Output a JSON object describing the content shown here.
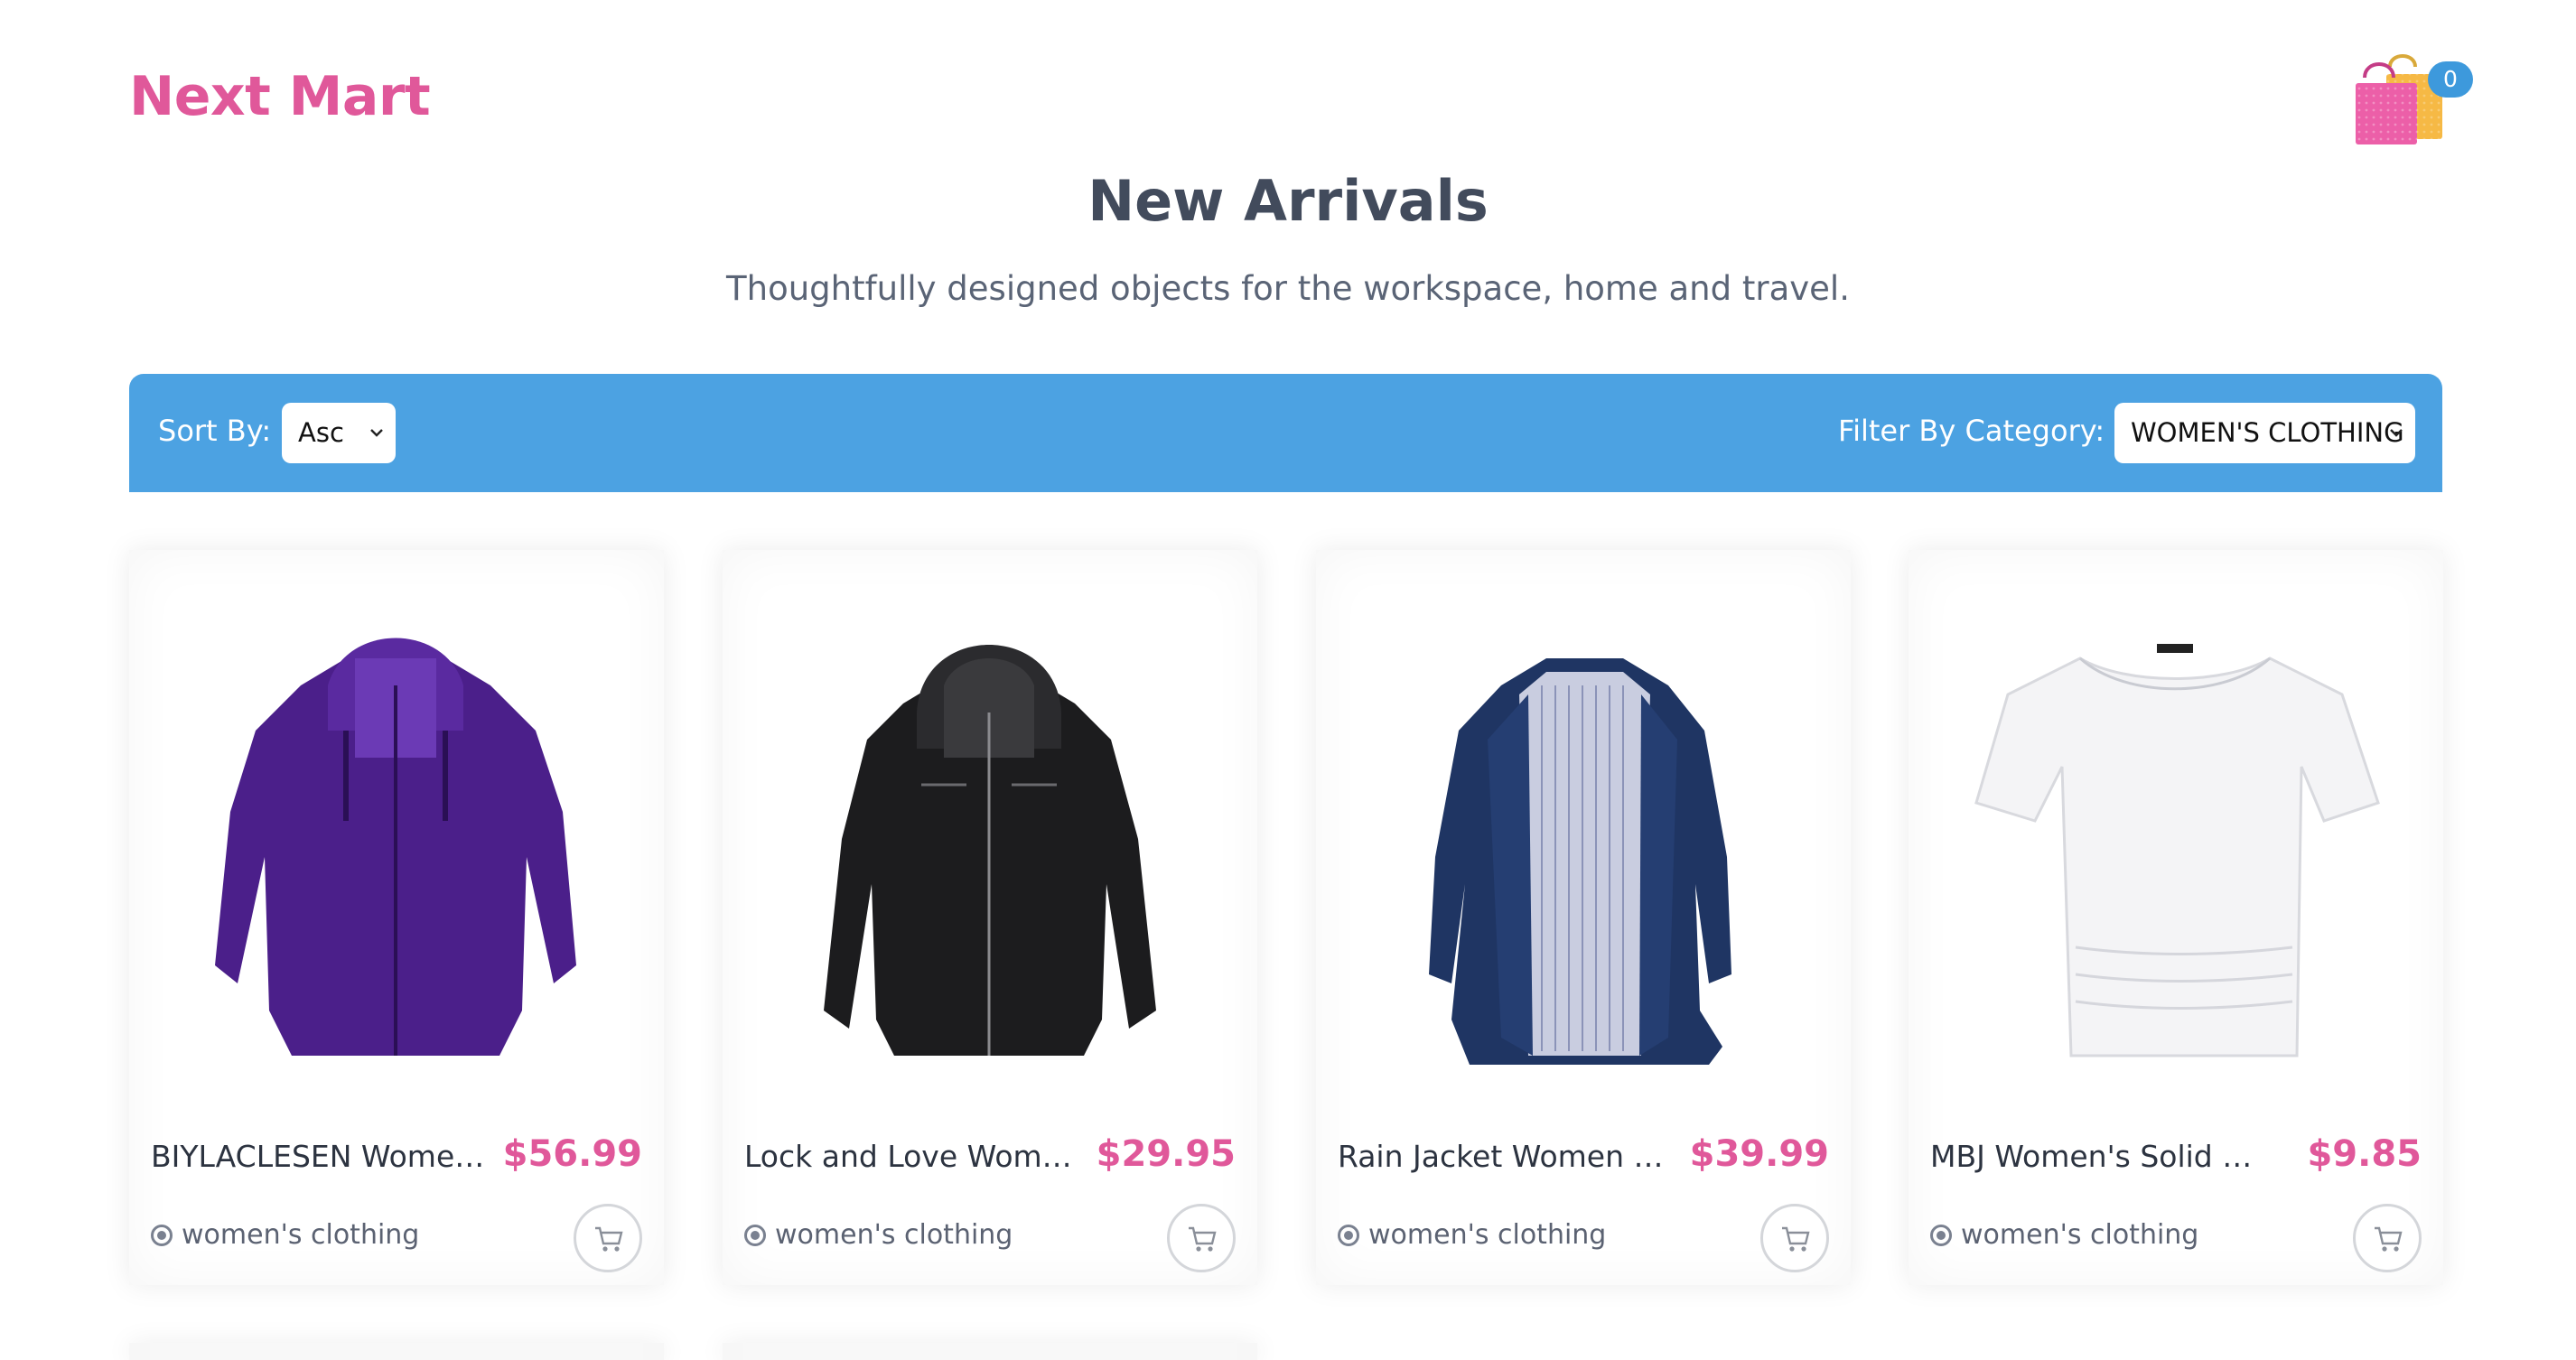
{
  "header": {
    "brand": "Next Mart",
    "cart_icon": "shopping-bags-icon",
    "cart_count": "0"
  },
  "hero": {
    "title": "New Arrivals",
    "subtitle": "Thoughtfully designed objects for the workspace, home and travel."
  },
  "toolbar": {
    "sort_label": "Sort By:",
    "sort_value": "Asc",
    "filter_label": "Filter By Category:",
    "filter_value": "WOMEN'S CLOTHING"
  },
  "products": [
    {
      "title": "BIYLACLESEN Women's ...",
      "price": "$56.99",
      "category": "women's clothing",
      "image": "purple-jacket"
    },
    {
      "title": "Lock and Love Women'...",
      "price": "$29.95",
      "category": "women's clothing",
      "image": "black-leather-jacket"
    },
    {
      "title": "Rain Jacket Women Wi...",
      "price": "$39.99",
      "category": "women's clothing",
      "image": "navy-rain-jacket"
    },
    {
      "title": "MBJ Women's Solid Sh...",
      "price": "$9.85",
      "category": "women's clothing",
      "image": "white-top"
    }
  ],
  "colors": {
    "brand": "#e0589a",
    "toolbar": "#4ca2e2",
    "badge": "#3d99dc",
    "price": "#e0589a"
  }
}
